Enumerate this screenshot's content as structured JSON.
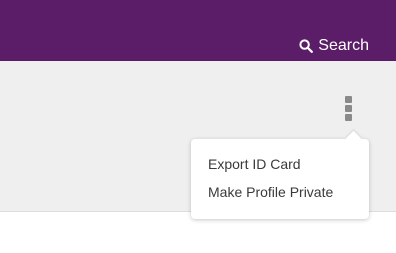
{
  "header": {
    "search_label": "Search",
    "search_icon": "search-icon",
    "background_color": "#5c1d68"
  },
  "toolbar": {
    "more_icon": "more-vertical-icon"
  },
  "menu": {
    "items": [
      {
        "label": "Export ID Card"
      },
      {
        "label": "Make Profile Private"
      }
    ]
  }
}
